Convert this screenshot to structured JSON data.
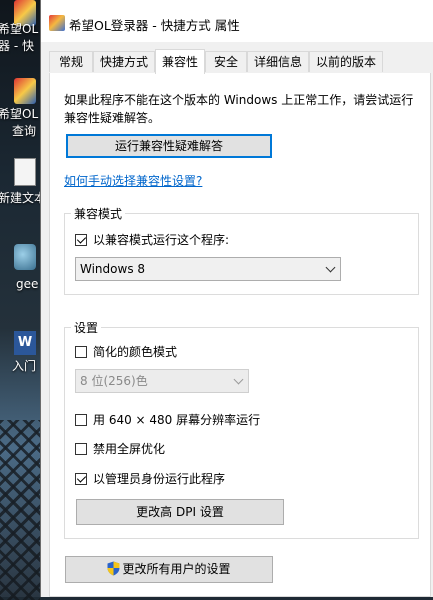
{
  "desktop": {
    "items": [
      {
        "label1": "希望OL",
        "label2": "器 - 快",
        "icon": "game-shortcut-icon"
      },
      {
        "label1": "希望OL",
        "label2": "查询",
        "icon": "game-query-icon"
      },
      {
        "label1": "新建文本",
        "icon": "text-document-icon"
      },
      {
        "label1": "gee",
        "icon": "gee-app-icon"
      },
      {
        "label1": "入门",
        "icon": "word-document-icon",
        "glyph": "W"
      }
    ]
  },
  "window": {
    "title": "希望OL登录器 - 快捷方式 属性"
  },
  "tabs": [
    {
      "label": "常规"
    },
    {
      "label": "快捷方式"
    },
    {
      "label": "兼容性",
      "active": true
    },
    {
      "label": "安全"
    },
    {
      "label": "详细信息"
    },
    {
      "label": "以前的版本"
    }
  ],
  "compat": {
    "intro": "如果此程序不能在这个版本的 Windows 上正常工作，请尝试运行兼容性疑难解答。",
    "troubleshooter_button": "运行兼容性疑难解答",
    "manual_link": "如何手动选择兼容性设置?",
    "mode_group": {
      "title": "兼容模式",
      "checkbox_label": "以兼容模式运行这个程序:",
      "checked": true,
      "os_selected": "Windows 8"
    },
    "settings_group": {
      "title": "设置",
      "reduced_color": {
        "label": "简化的颜色模式",
        "checked": false
      },
      "color_depth_selected": "8 位(256)色",
      "low_res": {
        "label": "用 640 × 480 屏幕分辨率运行",
        "checked": false
      },
      "disable_fullscreen_opt": {
        "label": "禁用全屏优化",
        "checked": false
      },
      "run_as_admin": {
        "label": "以管理员身份运行此程序",
        "checked": true
      },
      "dpi_button": "更改高 DPI 设置"
    },
    "all_users_button": "更改所有用户的设置"
  },
  "colors": {
    "link": "#0066cc",
    "focus": "#0078d7",
    "panel": "#ffffff",
    "window": "#f0f0f0"
  }
}
